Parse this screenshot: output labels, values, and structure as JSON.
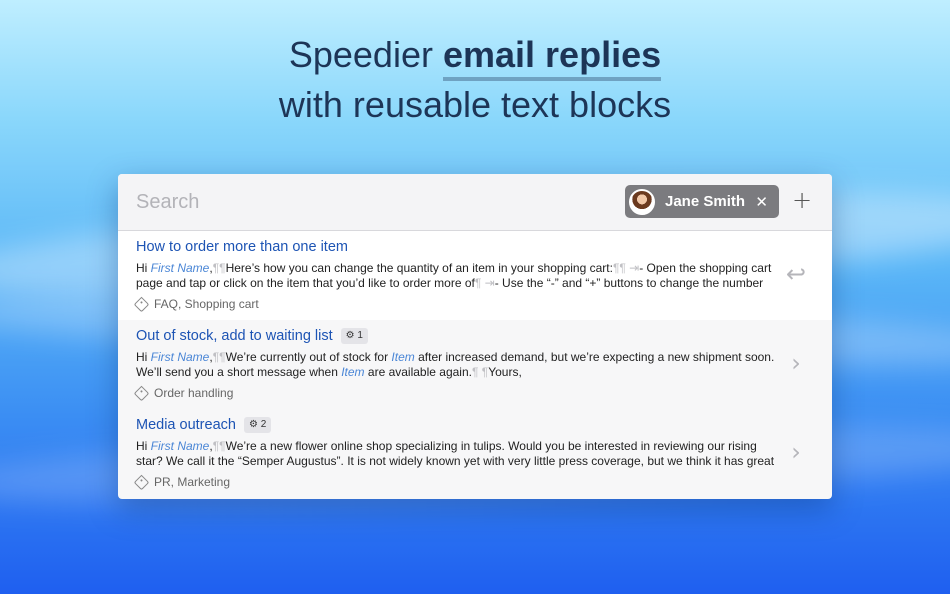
{
  "headline": {
    "line1_prefix": "Speedier",
    "line1_bold": "email replies",
    "line2": "with reusable text blocks"
  },
  "search": {
    "placeholder": "Search",
    "token_name": "Jane Smith",
    "token_close": "✕",
    "add_label": "+"
  },
  "items": [
    {
      "title": "How to order more than one item",
      "badge": "",
      "body": [
        {
          "t": "text",
          "v": "Hi "
        },
        {
          "t": "var",
          "v": "First Name"
        },
        {
          "t": "text",
          "v": ","
        },
        {
          "t": "pm",
          "v": "¶¶"
        },
        {
          "t": "text",
          "v": "Here’s how you can change the quantity of an item in your shopping cart:"
        },
        {
          "t": "pm",
          "v": "¶¶ ⇥"
        },
        {
          "t": "text",
          "v": "- Open the shopping cart page and tap or click on the item that you’d like to order more of"
        },
        {
          "t": "pm",
          "v": "¶ ⇥"
        },
        {
          "t": "text",
          "v": "- Use the “-” and “+” buttons to change the number of i..."
        }
      ],
      "tags": "FAQ, Shopping cart",
      "action_icon": "return-icon",
      "action_glyph": "↩"
    },
    {
      "title": "Out of stock, add to waiting list",
      "badge": "⚙ 1",
      "body": [
        {
          "t": "text",
          "v": "Hi "
        },
        {
          "t": "var",
          "v": "First Name"
        },
        {
          "t": "text",
          "v": ","
        },
        {
          "t": "pm",
          "v": "¶¶"
        },
        {
          "t": "text",
          "v": "We’re  currently out of stock for "
        },
        {
          "t": "var",
          "v": "Item"
        },
        {
          "t": "text",
          "v": " after increased demand, but we’re expecting a new shipment soon. We’ll send you a short message when "
        },
        {
          "t": "var",
          "v": "Item"
        },
        {
          "t": "text",
          "v": " are available again."
        },
        {
          "t": "pm",
          "v": "¶ ¶"
        },
        {
          "t": "text",
          "v": "Yours,"
        }
      ],
      "tags": "Order handling",
      "action_icon": "chevron-right-icon",
      "action_glyph": "›"
    },
    {
      "title": "Media outreach",
      "badge": "⚙ 2",
      "body": [
        {
          "t": "text",
          "v": "Hi "
        },
        {
          "t": "var",
          "v": "First Name"
        },
        {
          "t": "text",
          "v": ","
        },
        {
          "t": "pm",
          "v": "¶¶"
        },
        {
          "t": "text",
          "v": "We’re a new flower online shop specializing in tulips. Would you be interested in reviewing our rising star? We call it the “Semper Augustus”. It is not widely known yet with very little press coverage, but we think it has great potential."
        },
        {
          "t": "pm",
          "v": "¶"
        }
      ],
      "tags": "PR, Marketing",
      "action_icon": "chevron-right-icon",
      "action_glyph": "›"
    }
  ]
}
